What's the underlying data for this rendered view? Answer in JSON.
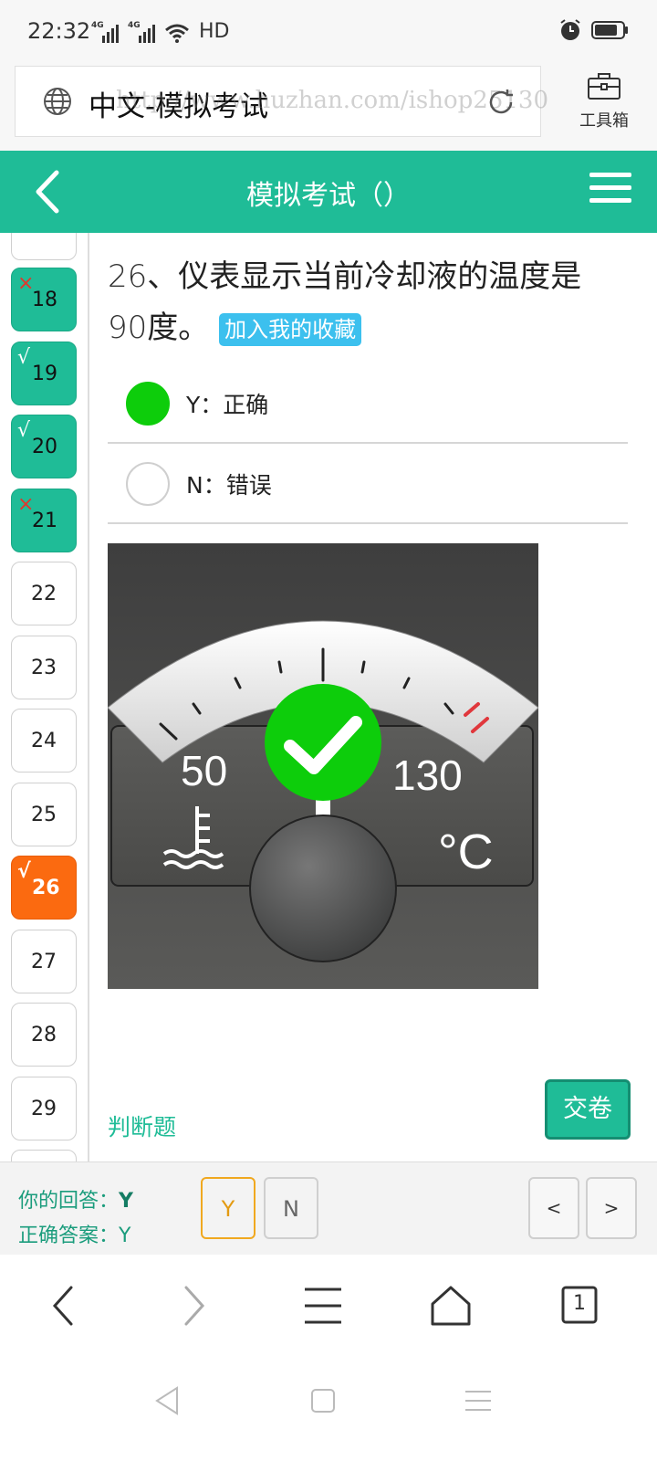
{
  "status_bar": {
    "time": "22:32",
    "network_1": "4G",
    "network_2": "4G",
    "hd": "HD"
  },
  "address_bar": {
    "title": "中文-模拟考试",
    "watermark": "http://www.huzhan.com/ishop25130",
    "toolbox_label": "工具箱"
  },
  "header": {
    "title": "模拟考试（）"
  },
  "sidebar": {
    "items": [
      {
        "num": "18",
        "state": "wrong",
        "mark": "×"
      },
      {
        "num": "19",
        "state": "right",
        "mark": "√"
      },
      {
        "num": "20",
        "state": "right",
        "mark": "√"
      },
      {
        "num": "21",
        "state": "wrong",
        "mark": "×"
      },
      {
        "num": "22",
        "state": "none",
        "mark": ""
      },
      {
        "num": "23",
        "state": "none",
        "mark": ""
      },
      {
        "num": "24",
        "state": "none",
        "mark": ""
      },
      {
        "num": "25",
        "state": "none",
        "mark": ""
      },
      {
        "num": "26",
        "state": "current",
        "mark": "√"
      },
      {
        "num": "27",
        "state": "none",
        "mark": ""
      },
      {
        "num": "28",
        "state": "none",
        "mark": ""
      },
      {
        "num": "29",
        "state": "none",
        "mark": ""
      }
    ]
  },
  "question": {
    "index": "26",
    "separator": "、",
    "text_line1": "仪表显示当前冷却液的温度是",
    "value": "90",
    "text_line2": "度。",
    "favorite_label": "加入我的收藏",
    "options": [
      {
        "label": "Y：正确",
        "selected": true
      },
      {
        "label": "N：错误",
        "selected": false
      }
    ],
    "gauge": {
      "min_label": "50",
      "max_label": "130",
      "unit": "°C"
    },
    "type_label": "判断题",
    "submit_label": "交卷"
  },
  "answer_bar": {
    "your_answer_label": "你的回答：",
    "your_answer_value": "Y",
    "correct_answer_label": "正确答案：",
    "correct_answer_value": "Y",
    "btn_y": "Y",
    "btn_n": "N",
    "prev": "<",
    "next": ">"
  },
  "browser_nav": {
    "tab_count": "1"
  },
  "colors": {
    "accent": "#1fbc97",
    "current": "#fb6a10",
    "selected": "#0dcd0b",
    "favorite": "#3cc0ee"
  }
}
